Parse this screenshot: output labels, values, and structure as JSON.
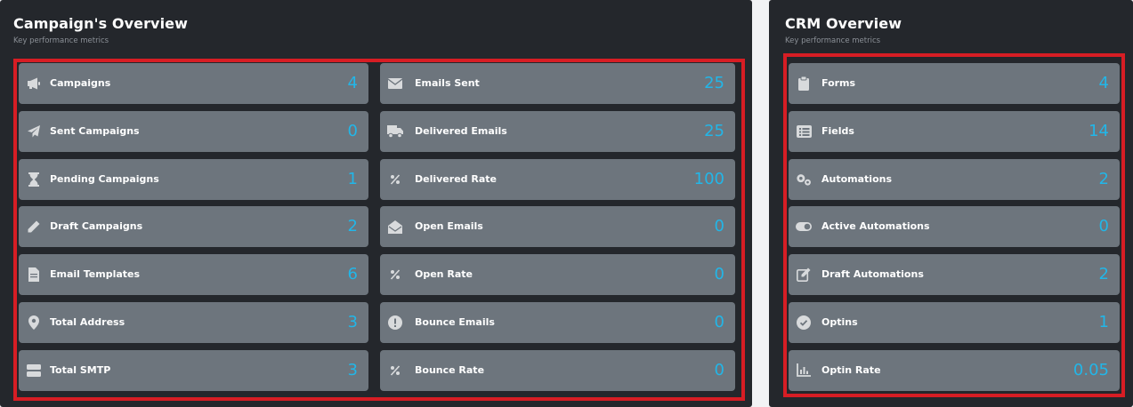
{
  "campaign_panel": {
    "title": "Campaign's Overview",
    "subtitle": "Key performance metrics",
    "left_column": [
      {
        "label": "Campaigns",
        "value": "4",
        "icon": "megaphone-icon"
      },
      {
        "label": "Sent Campaigns",
        "value": "0",
        "icon": "paper-plane-icon"
      },
      {
        "label": "Pending Campaigns",
        "value": "1",
        "icon": "hourglass-icon"
      },
      {
        "label": "Draft Campaigns",
        "value": "2",
        "icon": "pencil-icon"
      },
      {
        "label": "Email Templates",
        "value": "6",
        "icon": "document-icon"
      },
      {
        "label": "Total Address",
        "value": "3",
        "icon": "map-pin-icon"
      },
      {
        "label": "Total SMTP",
        "value": "3",
        "icon": "server-icon"
      }
    ],
    "right_column": [
      {
        "label": "Emails Sent",
        "value": "25",
        "icon": "envelope-icon"
      },
      {
        "label": "Delivered Emails",
        "value": "25",
        "icon": "truck-icon"
      },
      {
        "label": "Delivered Rate",
        "value": "100",
        "icon": "percent-icon"
      },
      {
        "label": "Open Emails",
        "value": "0",
        "icon": "envelope-open-icon"
      },
      {
        "label": "Open Rate",
        "value": "0",
        "icon": "percent-icon"
      },
      {
        "label": "Bounce Emails",
        "value": "0",
        "icon": "exclamation-circle-icon"
      },
      {
        "label": "Bounce Rate",
        "value": "0",
        "icon": "percent-icon"
      }
    ]
  },
  "crm_panel": {
    "title": "CRM Overview",
    "subtitle": "Key performance metrics",
    "items": [
      {
        "label": "Forms",
        "value": "4",
        "icon": "clipboard-icon"
      },
      {
        "label": "Fields",
        "value": "14",
        "icon": "list-icon"
      },
      {
        "label": "Automations",
        "value": "2",
        "icon": "gears-icon"
      },
      {
        "label": "Active Automations",
        "value": "0",
        "icon": "toggle-icon"
      },
      {
        "label": "Draft Automations",
        "value": "2",
        "icon": "edit-icon"
      },
      {
        "label": "Optins",
        "value": "1",
        "icon": "check-circle-icon"
      },
      {
        "label": "Optin Rate",
        "value": "0.05",
        "icon": "chart-icon"
      }
    ]
  },
  "colors": {
    "panel_bg": "#24272c",
    "card_bg": "#6d757d",
    "value_color": "#22b6e8",
    "highlight": "#d71d24"
  }
}
